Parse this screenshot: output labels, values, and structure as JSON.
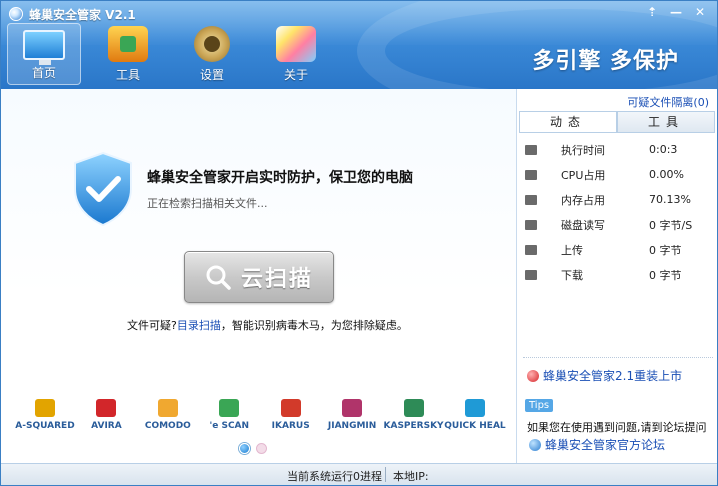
{
  "app": {
    "title": "蜂巢安全管家 V2.1",
    "slogan": "多引擎  多保护",
    "controls": [
      "⇡",
      "—",
      "✕"
    ]
  },
  "nav": [
    {
      "label": "首页",
      "icon": "monitor-icon",
      "active": true
    },
    {
      "label": "工具",
      "icon": "toolbox-icon",
      "active": false
    },
    {
      "label": "设置",
      "icon": "gear-icon",
      "active": false
    },
    {
      "label": "关于",
      "icon": "chart-icon",
      "active": false
    }
  ],
  "main": {
    "headline": "蜂巢安全管家开启实时防护，保卫您的电脑",
    "subline": "正在检索扫描相关文件...",
    "scan_button": "云扫描",
    "hint_prefix": "文件可疑?",
    "hint_link": "目录扫描",
    "hint_suffix": "，智能识别病毒木马，为您排除疑虑。",
    "partners": [
      {
        "name": "A-SQUARED",
        "color": "#e2a400"
      },
      {
        "name": "AVIRA",
        "color": "#d2262a"
      },
      {
        "name": "COMODO",
        "color": "#f0a830"
      },
      {
        "name": "'e SCAN",
        "color": "#3aa655"
      },
      {
        "name": "IKARUS",
        "color": "#d23a2a"
      },
      {
        "name": "JIANGMIN",
        "color": "#b0346a"
      },
      {
        "name": "KASPERSKY",
        "color": "#2e8b57"
      },
      {
        "name": "QUICK HEAL",
        "color": "#1f9ad6"
      }
    ]
  },
  "right": {
    "quarantine": "可疑文件隔离(0)",
    "tabs": [
      "动态",
      "工具"
    ],
    "stats": [
      {
        "label": "执行时间",
        "value": "0:0:3"
      },
      {
        "label": "CPU占用",
        "value": "0.00%"
      },
      {
        "label": "内存占用",
        "value": "70.13%"
      },
      {
        "label": "磁盘读写",
        "value": "0 字节/S"
      },
      {
        "label": "上传",
        "value": "0 字节"
      },
      {
        "label": "下载",
        "value": "0 字节"
      }
    ],
    "news": "蜂巢安全管家2.1重装上市",
    "tips_badge": "Tips",
    "tips_text": "如果您在使用遇到问题,请到论坛提问",
    "forum": "蜂巢安全管家官方论坛"
  },
  "status": {
    "running": "当前系统运行0进程",
    "ip": "本地IP:"
  }
}
